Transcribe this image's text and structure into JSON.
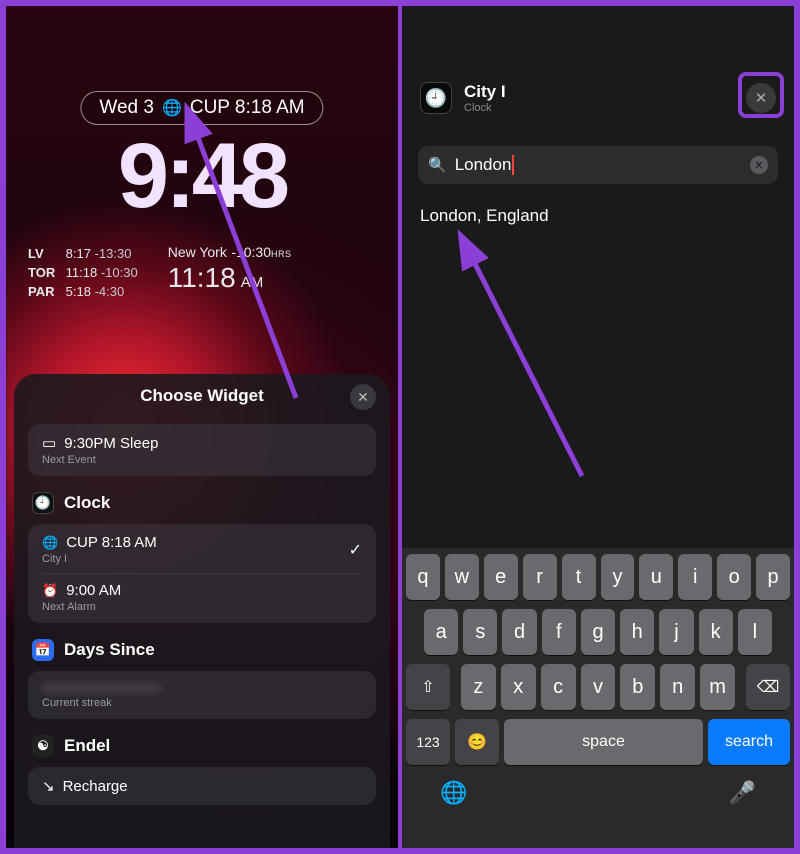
{
  "left": {
    "date_pill": {
      "day": "Wed 3",
      "world": "CUP 8:18 AM"
    },
    "big_time": "9:48",
    "tz_small": [
      {
        "lbl": "LV",
        "time": "8:17",
        "off": "-13:30"
      },
      {
        "lbl": "TOR",
        "time": "11:18",
        "off": "-10:30"
      },
      {
        "lbl": "PAR",
        "time": "5:18",
        "off": "-4:30"
      }
    ],
    "tz_big": {
      "city": "New York",
      "off": "-10:30",
      "hrs": "HRS",
      "time": "11:18",
      "suf": "AM"
    },
    "sheet": {
      "title": "Choose Widget",
      "calendar": {
        "title": "9:30PM Sleep",
        "sub": "Next Event"
      },
      "clock_label": "Clock",
      "clock": {
        "world": {
          "title": "CUP 8:18 AM",
          "sub": "City I"
        },
        "alarm": {
          "title": "9:00 AM",
          "sub": "Next Alarm"
        }
      },
      "days_label": "Days Since",
      "days_sub": "Current streak",
      "endel_label": "Endel",
      "recharge": "Recharge"
    }
  },
  "right": {
    "header": {
      "title": "City I",
      "sub": "Clock"
    },
    "search": {
      "value": "London"
    },
    "result": "London, England",
    "keyboard": {
      "row1": [
        "q",
        "w",
        "e",
        "r",
        "t",
        "y",
        "u",
        "i",
        "o",
        "p"
      ],
      "row2": [
        "a",
        "s",
        "d",
        "f",
        "g",
        "h",
        "j",
        "k",
        "l"
      ],
      "row3": [
        "z",
        "x",
        "c",
        "v",
        "b",
        "n",
        "m"
      ],
      "num": "123",
      "space": "space",
      "search": "search"
    }
  }
}
